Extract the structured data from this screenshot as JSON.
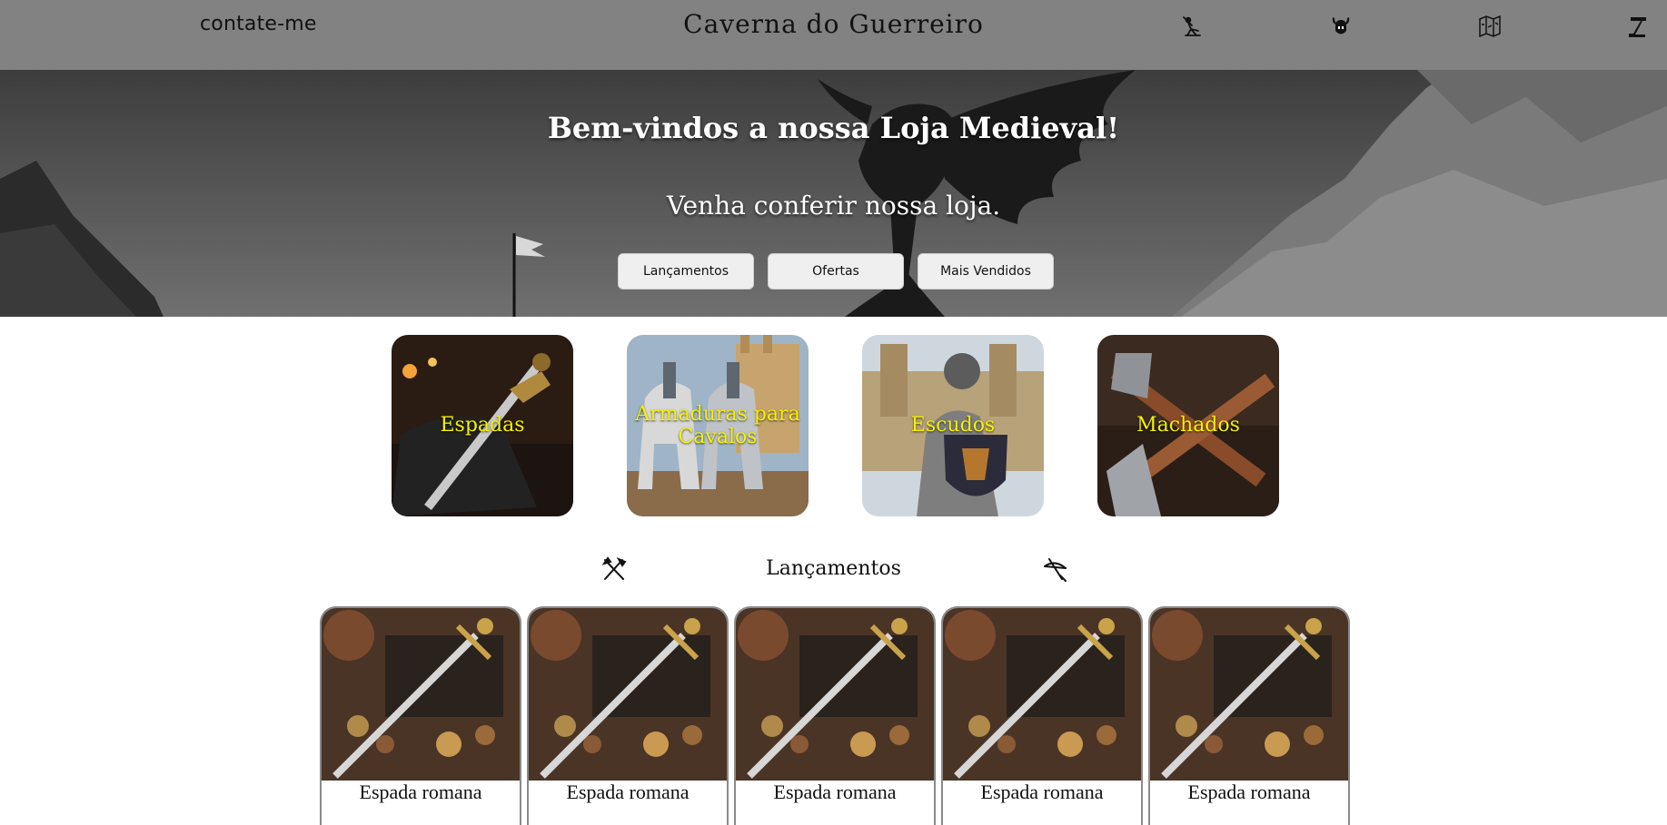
{
  "header": {
    "contact_label": "contate-me",
    "brand": "Caverna do Guerreiro",
    "icons": [
      "swordsman-icon",
      "viking-helmet-icon",
      "map-icon",
      "scroll-icon"
    ]
  },
  "hero": {
    "title": "Bem-vindos a nossa Loja Medieval!",
    "subtitle": "Venha conferir nossa loja.",
    "buttons": [
      "Lançamentos",
      "Ofertas",
      "Mais Vendidos"
    ]
  },
  "categories": [
    {
      "label": "Espadas"
    },
    {
      "label": "Armaduras para Cavalos"
    },
    {
      "label": "Escudos"
    },
    {
      "label": "Machados"
    }
  ],
  "section": {
    "title": "Lançamentos",
    "left_icon": "crossed-axes-icon",
    "right_icon": "crossbow-icon"
  },
  "products": [
    {
      "name": "Espada romana"
    },
    {
      "name": "Espada romana"
    },
    {
      "name": "Espada romana"
    },
    {
      "name": "Espada romana"
    },
    {
      "name": "Espada romana"
    }
  ],
  "colors": {
    "header_bg": "#828282",
    "category_label": "#f6f200",
    "button_bg": "#efefef"
  }
}
